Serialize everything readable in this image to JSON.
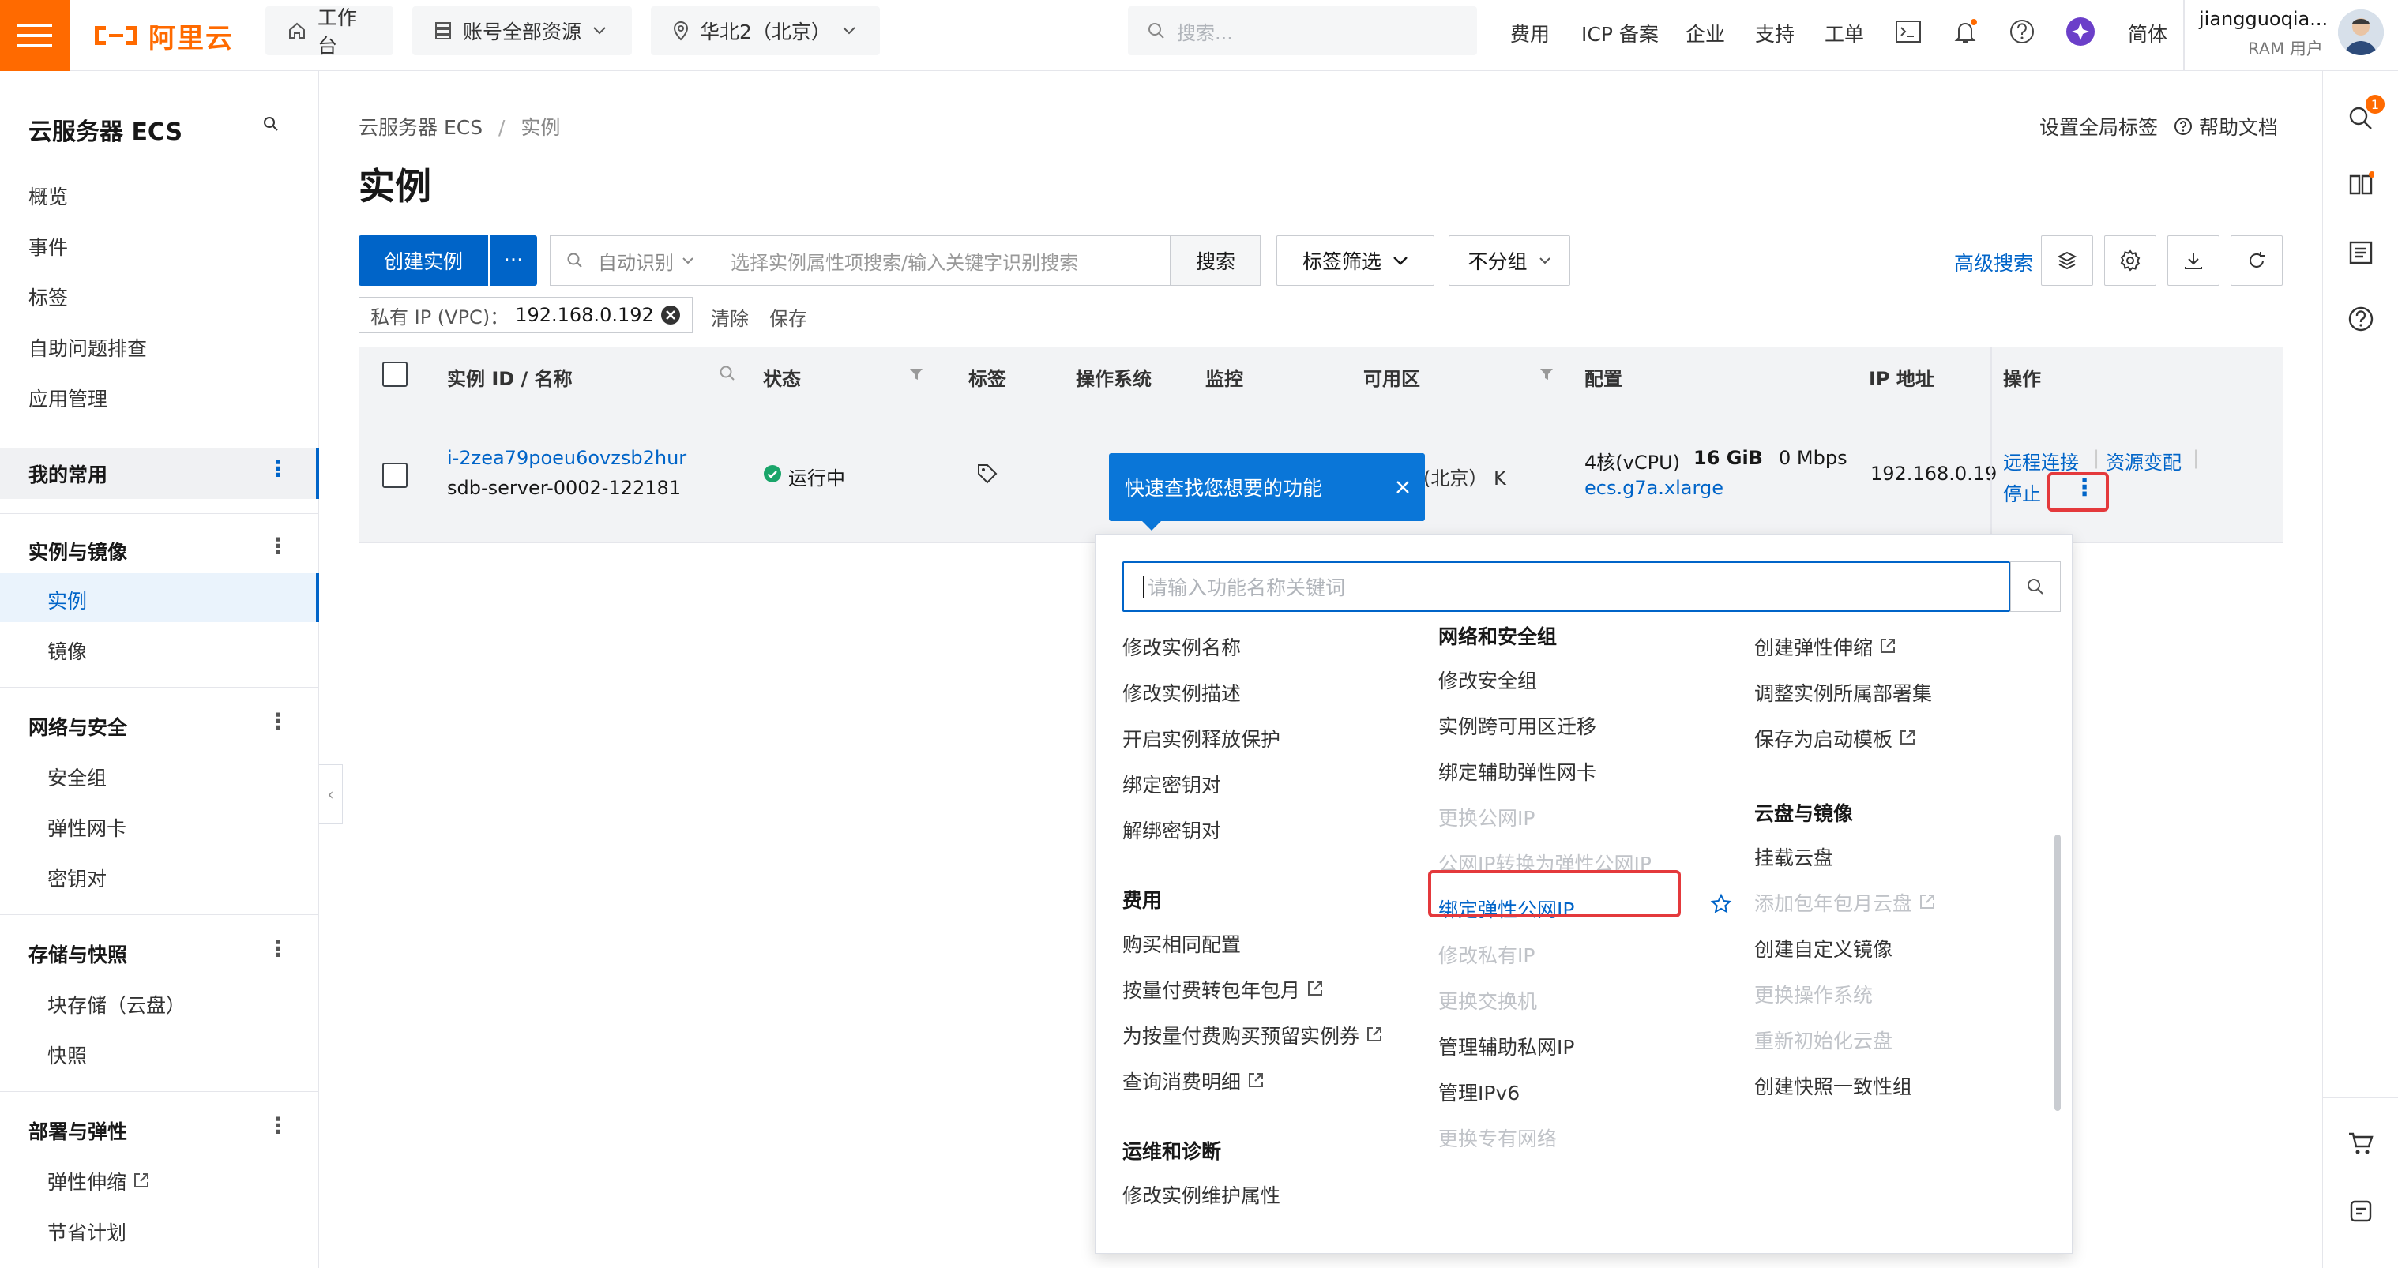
{
  "topbar": {
    "logo_text": "阿里云",
    "workbench": "工作台",
    "resources": "账号全部资源",
    "region": "华北2（北京）",
    "search_placeholder": "搜索...",
    "links": [
      "费用",
      "ICP 备案",
      "企业",
      "支持",
      "工单"
    ],
    "lang": "简体",
    "user_name": "jiangguoqia...",
    "user_role": "RAM 用户"
  },
  "sidebar": {
    "title": "云服务器 ECS",
    "top_items": [
      "概览",
      "事件",
      "标签",
      "自助问题排查",
      "应用管理"
    ],
    "mine": "我的常用",
    "groups": [
      {
        "label": "实例与镜像",
        "items": [
          "实例",
          "镜像"
        ]
      },
      {
        "label": "网络与安全",
        "items": [
          "安全组",
          "弹性网卡",
          "密钥对"
        ]
      },
      {
        "label": "存储与快照",
        "items": [
          "块存储（云盘）",
          "快照"
        ]
      },
      {
        "label": "部署与弹性",
        "items": [
          "弹性伸缩",
          "节省计划"
        ]
      }
    ]
  },
  "rail": {
    "badge": "1"
  },
  "main": {
    "breadcrumb": [
      "云服务器 ECS",
      "/",
      "实例"
    ],
    "title": "实例",
    "set_tags": "设置全局标签",
    "help": "帮助文档",
    "create": "创建实例",
    "create_more": "···",
    "auto_detect": "自动识别",
    "filter_placeholder": "选择实例属性项搜索/输入关键字识别搜索",
    "search": "搜索",
    "tag_filter": "标签筛选",
    "group": "不分组",
    "advanced": "高级搜索",
    "chip_label": "私有 IP (VPC)：",
    "chip_value": "192.168.0.192",
    "clear": "清除",
    "save": "保存"
  },
  "table": {
    "headers": [
      "实例 ID / 名称",
      "状态",
      "标签",
      "操作系统",
      "监控",
      "可用区",
      "配置",
      "IP 地址",
      "操作"
    ],
    "row": {
      "id": "i-2zea79poeu6ovzsb2hur",
      "name": "sdb-server-0002-122181",
      "status": "运行中",
      "zone_partial": "北京）  K",
      "zone_paren": "(",
      "config_cores": "4核(vCPU)",
      "config_mem": "16 GiB",
      "config_bw": "0 Mbps",
      "spec": "ecs.g7a.xlarge",
      "ip": "192.168.0.19",
      "ops": [
        "远程连接",
        "资源变配",
        "停止"
      ]
    }
  },
  "tooltip": {
    "text": "快速查找您想要的功能"
  },
  "popup": {
    "placeholder": "请输入功能名称关键词",
    "col1": {
      "items": [
        "修改实例名称",
        "修改实例描述",
        "开启实例释放保护",
        "绑定密钥对",
        "解绑密钥对"
      ],
      "fee_header": "费用",
      "fee_items": [
        "购买相同配置",
        "按量付费转包年包月",
        "为按量付费购买预留实例券",
        "查询消费明细"
      ],
      "ops_header": "运维和诊断",
      "ops_items": [
        "修改实例维护属性"
      ]
    },
    "col2": {
      "header": "网络和安全组",
      "items": [
        "修改安全组",
        "实例跨可用区迁移",
        "绑定辅助弹性网卡",
        "更换公网IP",
        "公网IP转换为弹性公网IP",
        "绑定弹性公网IP",
        "修改私有IP",
        "更换交换机",
        "管理辅助私网IP",
        "管理IPv6",
        "更换专有网络"
      ]
    },
    "col3": {
      "items": [
        "创建弹性伸缩",
        "调整实例所属部署集",
        "保存为启动模板"
      ],
      "disk_header": "云盘与镜像",
      "disk_items": [
        "挂载云盘",
        "添加包年包月云盘",
        "创建自定义镜像",
        "更换操作系统",
        "重新初始化云盘",
        "创建快照一致性组"
      ]
    }
  },
  "colors": {
    "brand": "#ff6a00",
    "primary": "#0064c8",
    "highlight": "#e4393c"
  }
}
